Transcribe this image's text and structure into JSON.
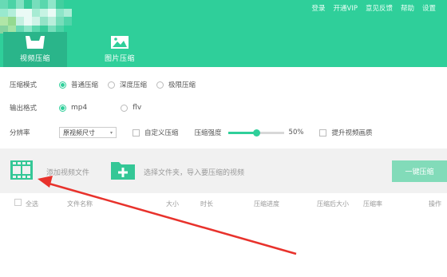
{
  "colors": {
    "accent": "#2fcf9a",
    "tab_active": "#2ab58a",
    "button": "#82dbb9",
    "arrow": "#e8322c"
  },
  "topnav": [
    "登录",
    "开通VIP",
    "意见反馈",
    "帮助",
    "设置"
  ],
  "tabs": [
    {
      "label": "视频压缩",
      "icon": "video-compress-icon",
      "active": true
    },
    {
      "label": "图片压缩",
      "icon": "image-icon",
      "active": false
    }
  ],
  "settings": {
    "mode": {
      "label": "压缩模式",
      "options": [
        "普通压缩",
        "深度压缩",
        "极限压缩"
      ],
      "selected": "普通压缩"
    },
    "format": {
      "label": "输出格式",
      "options": [
        "mp4",
        "flv"
      ],
      "selected": "mp4"
    },
    "resolution": {
      "label": "分辨率",
      "value": "原视频尺寸",
      "custom_label": "自定义压缩",
      "strength_label": "压缩强度",
      "strength_value": "50%",
      "strength_fraction": 0.5,
      "enhance_label": "提升视频画质"
    }
  },
  "toolbar": {
    "add_video": "添加视频文件",
    "select_folder": "选择文件夹，导入要压缩的视频",
    "compress_button": "一键压缩"
  },
  "table": {
    "select_all": "全选",
    "columns": [
      "文件名称",
      "大小",
      "时长",
      "压缩进度",
      "压缩后大小",
      "压缩率",
      "操作"
    ]
  }
}
